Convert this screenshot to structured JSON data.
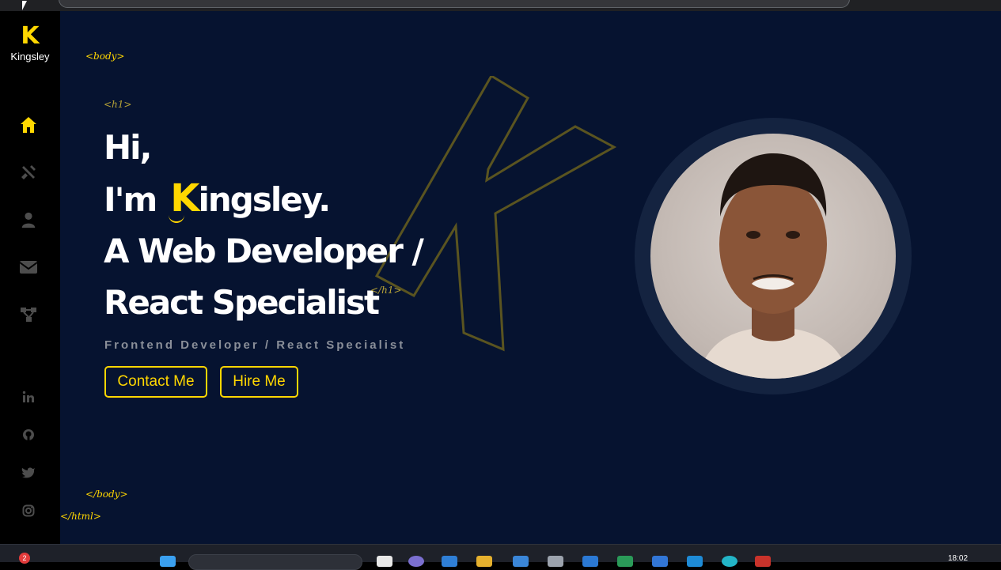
{
  "logo": {
    "letter": "K",
    "name": "Kingsley"
  },
  "nav": {
    "items": [
      "home-icon",
      "tools-icon",
      "user-icon",
      "envelope-icon",
      "sitemap-icon"
    ],
    "active": "home-icon"
  },
  "social": [
    "linkedin-icon",
    "github-icon",
    "twitter-icon",
    "instagram-icon"
  ],
  "tags": {
    "body_open": "<body>",
    "h1_open": "<h1>",
    "h1_close": "</h1>",
    "body_close": "</body>",
    "html_close": "</html>"
  },
  "hero": {
    "line1": "Hi,",
    "line2_prefix": "I'm",
    "line2_k": "K",
    "line2_rest": "ingsley.",
    "line3": "A Web Developer /",
    "line4": "React Specialist",
    "subtitle": "Frontend Developer / React Specialist",
    "contact_label": "Contact Me",
    "hire_label": "Hire Me"
  },
  "taskbar": {
    "time": "18:02",
    "badge_count": "2"
  },
  "colors": {
    "accent": "#ffd700",
    "background": "#061330",
    "sidebar": "#000000"
  }
}
